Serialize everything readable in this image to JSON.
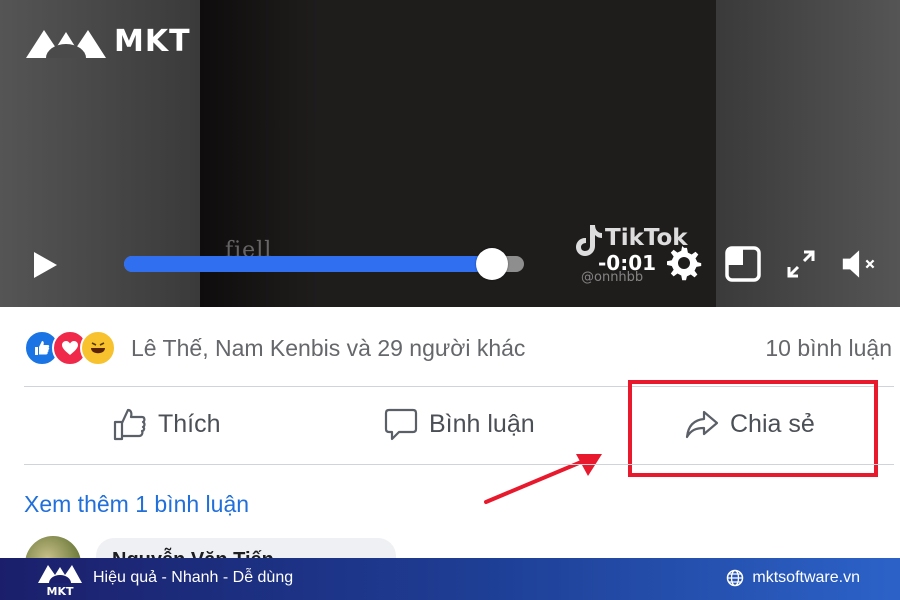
{
  "brand": {
    "name": "MKT"
  },
  "video": {
    "watermark": "fiell",
    "tiktok_name": "TikTok",
    "tiktok_user": "@onnhbb",
    "time_remaining": "-0:01",
    "progress": 0.92
  },
  "post": {
    "reactions": [
      "like-icon",
      "love-icon",
      "haha-icon"
    ],
    "reaction_text": "Lê Thế, Nam Kenbis và 29 người khác",
    "comments_count": "10 bình luận",
    "actions": {
      "like_label": "Thích",
      "comment_label": "Bình luận",
      "share_label": "Chia sẻ"
    },
    "see_more": "Xem thêm 1 bình luận",
    "comment_preview_name": "Nguyễn Văn Tiến"
  },
  "footer": {
    "tagline": "Hiệu quả - Nhanh - Dễ dùng",
    "website": "mktsoftware.vn"
  },
  "colors": {
    "accent": "#2f6ff0",
    "highlight": "#e8192c",
    "link": "#216fdb"
  }
}
